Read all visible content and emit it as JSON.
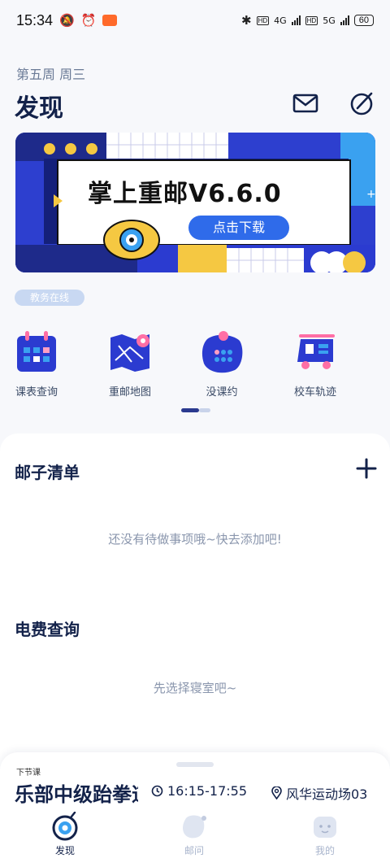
{
  "status_bar": {
    "time": "15:34",
    "network_4g": "4G",
    "network_5g": "5G",
    "hd": "HD",
    "battery": "60",
    "icons": [
      "mute-icon",
      "alarm-icon",
      "screen-record-icon",
      "bluetooth-icon",
      "signal-icon",
      "battery-icon"
    ]
  },
  "header": {
    "week": "第五周 周三",
    "title": "发现",
    "icons": [
      "mail-icon",
      "edit-icon"
    ]
  },
  "banner": {
    "title": "掌上重邮V6.6.0",
    "button_label": "点击下载"
  },
  "tag": "教务在线",
  "services": [
    {
      "label": "课表查询",
      "icon": "calendar-icon"
    },
    {
      "label": "重邮地图",
      "icon": "map-icon"
    },
    {
      "label": "没课约",
      "icon": "schedule-icon"
    },
    {
      "label": "校车轨迹",
      "icon": "bus-icon"
    }
  ],
  "todo": {
    "title": "邮子清单",
    "empty_text": "还没有待做事项哦~快去添加吧!"
  },
  "electricity": {
    "title": "电费查询",
    "empty_text": "先选择寝室吧~"
  },
  "next_class": {
    "label": "下节课",
    "course": "乐部中级跆拳道",
    "time": "16:15-17:55",
    "location": "风华运动场03"
  },
  "tabs": [
    {
      "label": "发现",
      "icon": "discover-icon",
      "active": true
    },
    {
      "label": "邮问",
      "icon": "ask-icon",
      "active": false
    },
    {
      "label": "我的",
      "icon": "profile-icon",
      "active": false
    }
  ],
  "colors": {
    "primary": "#2f6bea",
    "title": "#13224a",
    "banner_blue": "#2d3fcf",
    "banner_yellow": "#f5c842",
    "tab_active": "#13224a",
    "tab_inactive": "#a8b4cc"
  }
}
